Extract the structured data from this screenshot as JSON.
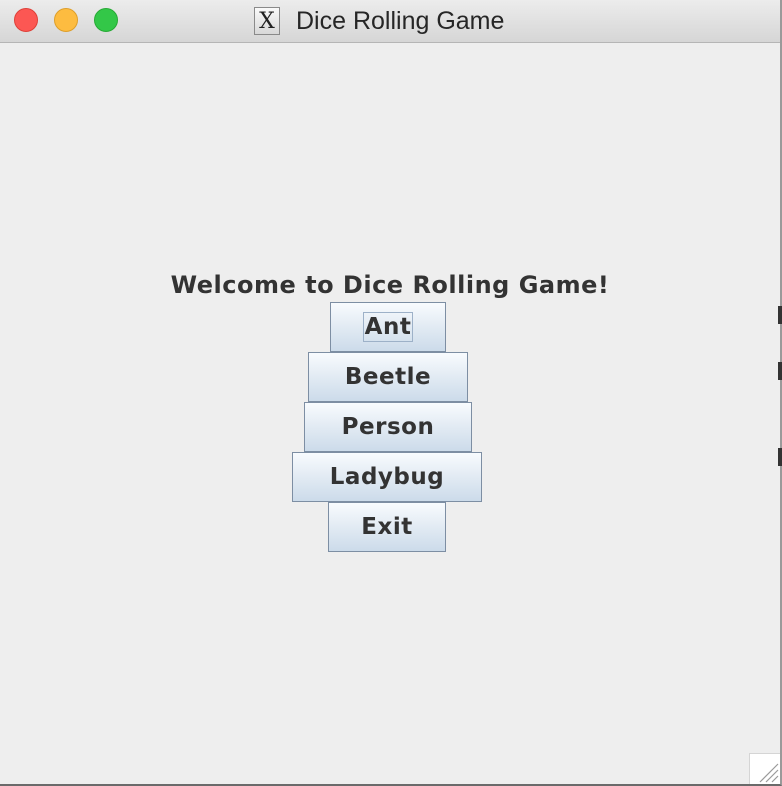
{
  "window": {
    "title": "Dice Rolling Game",
    "app_icon_glyph": "X",
    "controls": [
      "close",
      "minimize",
      "zoom"
    ]
  },
  "content": {
    "welcome": "Welcome to Dice Rolling Game!",
    "buttons": {
      "ant": "Ant",
      "beetle": "Beetle",
      "person": "Person",
      "ladybug": "Ladybug",
      "exit": "Exit"
    },
    "focused_button": "Ant"
  },
  "colors": {
    "window_bg": "#eeeeee",
    "button_border": "#7d8ea3",
    "button_gradient_top": "#f8fbfe",
    "button_gradient_bottom": "#ccdbea",
    "text": "#333333",
    "close": "#fc5753",
    "minimize": "#fdbc40",
    "zoom": "#33c748"
  },
  "icons": {
    "close": "close-icon",
    "minimize": "minimize-icon",
    "zoom": "zoom-icon",
    "app": "x11-app-icon",
    "resize": "resize-grip-icon"
  }
}
